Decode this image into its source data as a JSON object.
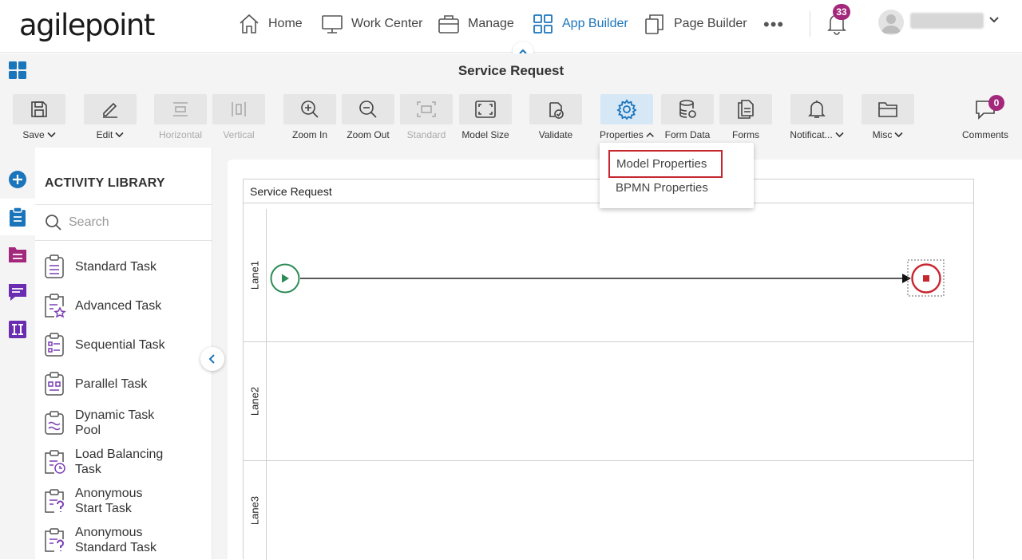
{
  "brand": {
    "logo_text": "agilepoint"
  },
  "nav": {
    "items": [
      {
        "label": "Home",
        "icon": "home-icon"
      },
      {
        "label": "Work Center",
        "icon": "monitor-icon"
      },
      {
        "label": "Manage",
        "icon": "briefcase-icon"
      },
      {
        "label": "App Builder",
        "icon": "grid-icon",
        "active": true
      },
      {
        "label": "Page Builder",
        "icon": "pages-icon"
      }
    ],
    "more": "•••",
    "notifications_count": "33"
  },
  "titlebar": {
    "title": "Service Request"
  },
  "toolbar": {
    "save": "Save",
    "edit": "Edit",
    "horizontal": "Horizontal",
    "vertical": "Vertical",
    "zoom_in": "Zoom In",
    "zoom_out": "Zoom Out",
    "standard": "Standard",
    "model_size": "Model Size",
    "validate": "Validate",
    "properties": "Properties",
    "form_data": "Form Data",
    "forms": "Forms",
    "notifications": "Notificat...",
    "misc": "Misc",
    "comments": "Comments",
    "comments_count": "0"
  },
  "properties_menu": {
    "items": [
      {
        "label": "Model Properties",
        "highlighted": true
      },
      {
        "label": "BPMN Properties"
      }
    ]
  },
  "library": {
    "title": "ACTIVITY LIBRARY",
    "search_placeholder": "Search",
    "items": [
      {
        "label": "Standard Task"
      },
      {
        "label": "Advanced Task"
      },
      {
        "label": "Sequential Task"
      },
      {
        "label": "Parallel Task"
      },
      {
        "label": "Dynamic Task Pool"
      },
      {
        "label": "Load Balancing Task"
      },
      {
        "label": "Anonymous Start Task"
      },
      {
        "label": "Anonymous Standard Task"
      }
    ]
  },
  "process": {
    "pool_name": "Service Request",
    "lanes": [
      "Lane1",
      "Lane2",
      "Lane3"
    ]
  },
  "colors": {
    "accent": "#1b75bb",
    "badge": "#a3287b",
    "start_event": "#2e8b57",
    "end_event": "#c8262f",
    "highlight_border": "#c8262f"
  }
}
